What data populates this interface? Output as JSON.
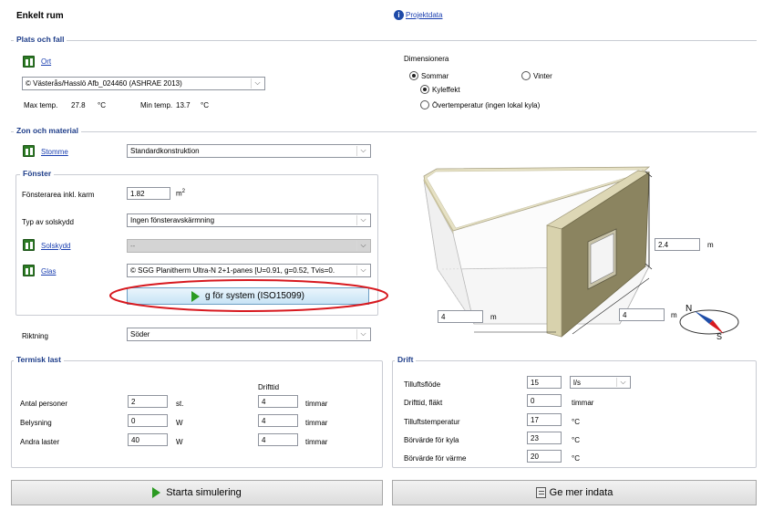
{
  "header": {
    "title": "Enkelt rum",
    "project_link": "Projektdata"
  },
  "location": {
    "legend": "Plats och fall",
    "ort_label": "Ort",
    "site_value": "© Västerås/Hasslö Afb_024460 (ASHRAE 2013)",
    "max_label": "Max temp.",
    "max_value": "27.8",
    "max_unit": "°C",
    "min_label": "Min temp.",
    "min_value": "13.7",
    "min_unit": "°C"
  },
  "dimension": {
    "title": "Dimensionera",
    "summer": "Sommar",
    "winter": "Vinter",
    "cooling": "Kyleffekt",
    "overtemp": "Övertemperatur (ingen lokal kyla)"
  },
  "zone": {
    "legend": "Zon och material",
    "stomme_label": "Stomme",
    "stomme_value": "Standardkonstruktion",
    "window_legend": "Fönster",
    "area_label": "Fönsterarea inkl. karm",
    "area_value": "1.82",
    "area_unit": "m",
    "shading_label": "Typ av solskydd",
    "shading_value": "Ingen fönsteravskärmning",
    "solskydd_label": "Solskydd",
    "solskydd_value": "--",
    "glas_label": "Glas",
    "glas_value": "© SGG Planitherm Ultra-N 2+1-panes [U=0.91, g=0.52, Tvis=0.",
    "g_button": "g för system (ISO15099)",
    "direction_label": "Riktning",
    "direction_value": "Söder"
  },
  "room": {
    "height_value": "2.4",
    "depth_value": "4",
    "width_value": "4",
    "unit": "m",
    "compass_n": "N",
    "compass_s": "S"
  },
  "thermal": {
    "legend": "Termisk last",
    "drifttid_header": "Drifttid",
    "rows": [
      {
        "label": "Antal personer",
        "value": "2",
        "unit": "st.",
        "time": "4",
        "time_unit": "timmar"
      },
      {
        "label": "Belysning",
        "value": "0",
        "unit": "W",
        "time": "4",
        "time_unit": "timmar"
      },
      {
        "label": "Andra laster",
        "value": "40",
        "unit": "W",
        "time": "4",
        "time_unit": "timmar"
      }
    ]
  },
  "drift": {
    "legend": "Drift",
    "flow_label": "Tilluftsflöde",
    "flow_value": "15",
    "flow_unit": "l/s",
    "time_label": "Drifttid, fläkt",
    "time_value": "0",
    "time_unit": "timmar",
    "supply_label": "Tilluftstemperatur",
    "supply_value": "17",
    "supply_unit": "°C",
    "cool_label": "Börvärde för kyla",
    "cool_value": "23",
    "cool_unit": "°C",
    "heat_label": "Börvärde för värme",
    "heat_value": "20",
    "heat_unit": "°C"
  },
  "actions": {
    "start": "Starta simulering",
    "more": "Ge mer indata"
  },
  "colors": {
    "accent": "#1f3e8a",
    "highlight": "#d7191f",
    "wall": "#8b8460"
  }
}
